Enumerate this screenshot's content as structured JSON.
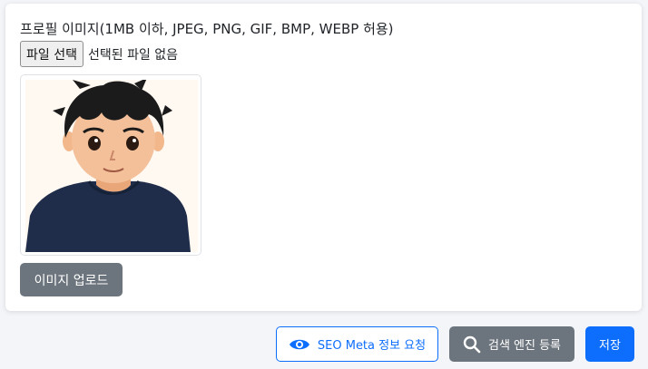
{
  "profile": {
    "image_label": "프로필 이미지(1MB 이하, JPEG, PNG, GIF, BMP, WEBP 허용)",
    "file_button_label": "파일 선택",
    "file_status": "선택된 파일 없음",
    "upload_button_label": "이미지 업로드"
  },
  "actions": {
    "seo_meta_label": "SEO Meta 정보 요청",
    "search_engine_label": "검색 엔진 등록",
    "save_label": "저장"
  },
  "colors": {
    "primary": "#0d6efd",
    "secondary": "#6c757d",
    "page_background": "#f3f5f9"
  }
}
